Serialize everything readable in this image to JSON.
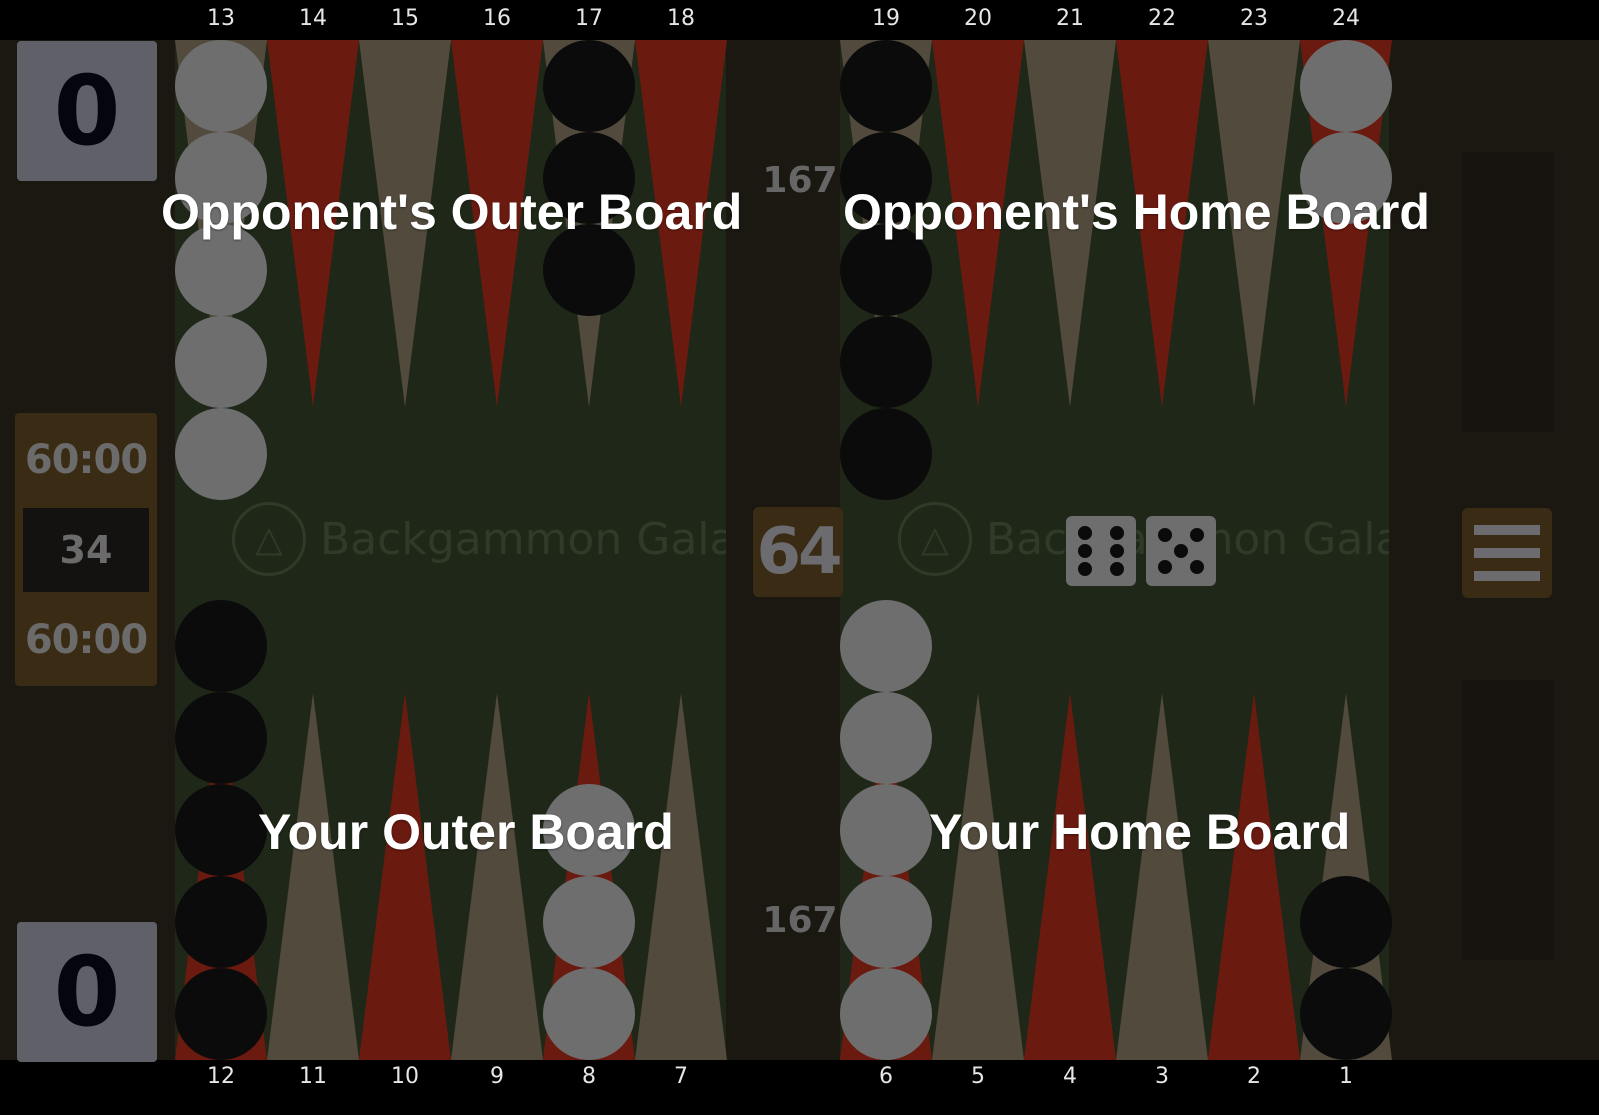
{
  "point_numbers_top": [
    "13",
    "14",
    "15",
    "16",
    "17",
    "18",
    "19",
    "20",
    "21",
    "22",
    "23",
    "24"
  ],
  "point_numbers_bottom": [
    "12",
    "11",
    "10",
    "9",
    "8",
    "7",
    "6",
    "5",
    "4",
    "3",
    "2",
    "1"
  ],
  "scores": {
    "top": "0",
    "bottom": "0"
  },
  "clock": {
    "top_time": "60:00",
    "move_count": "34",
    "bottom_time": "60:00"
  },
  "doubling_cube": "64",
  "pip_counts": {
    "top": "167",
    "bottom": "167"
  },
  "overlay_labels": {
    "opp_outer": "Opponent's Outer Board",
    "opp_home": "Opponent's Home Board",
    "your_outer": "Your Outer Board",
    "your_home": "Your Home Board"
  },
  "watermark": "Backgammon Galaxy",
  "dice": [
    6,
    5
  ],
  "colors": {
    "red_point": "#6b1a10",
    "tan_point": "#524a3c",
    "felt": "#1f2818",
    "white_checker": "#6e6e6e",
    "black_checker": "#0b0b0b"
  },
  "checkers": {
    "13": {
      "color": "white",
      "count": 5
    },
    "17": {
      "color": "black",
      "count": 3
    },
    "19": {
      "color": "black",
      "count": 5
    },
    "24": {
      "color": "white",
      "count": 2
    },
    "12": {
      "color": "black",
      "count": 5
    },
    "8": {
      "color": "white",
      "count": 3
    },
    "6": {
      "color": "white",
      "count": 5
    },
    "1": {
      "color": "black",
      "count": 2
    }
  },
  "icons": {
    "menu": "hamburger-menu-icon",
    "logo": "galaxy-logo-icon"
  }
}
